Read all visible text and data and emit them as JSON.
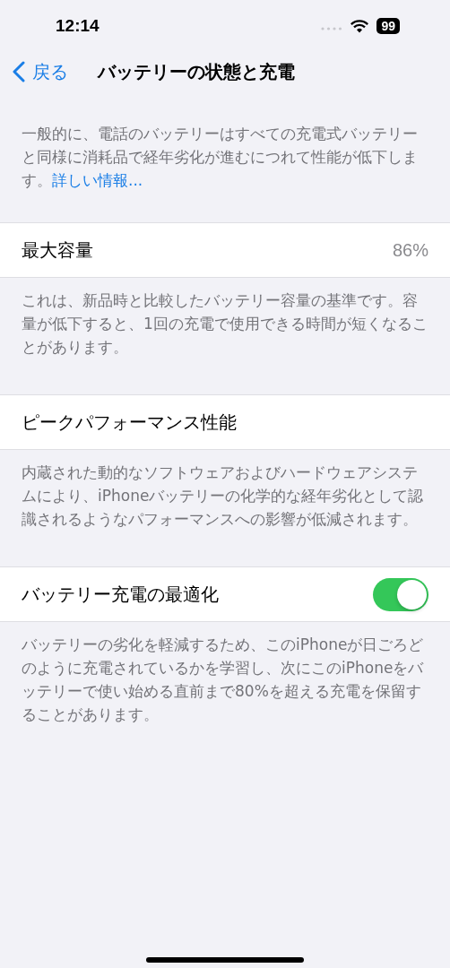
{
  "status_bar": {
    "time": "12:14",
    "battery": "99"
  },
  "nav": {
    "back": "戻る",
    "title": "バッテリーの状態と充電"
  },
  "intro": {
    "text": "一般的に、電話のバッテリーはすべての充電式バッテリーと同様に消耗品で経年劣化が進むにつれて性能が低下します。",
    "link": "詳しい情報..."
  },
  "sections": [
    {
      "kind": "value",
      "label": "最大容量",
      "value": "86%",
      "footer": "これは、新品時と比較したバッテリー容量の基準です。容量が低下すると、1回の充電で使用できる時間が短くなることがあります。"
    },
    {
      "kind": "plain",
      "label": "ピークパフォーマンス性能",
      "footer": "内蔵された動的なソフトウェアおよびハードウェアシステムにより、iPhoneバッテリーの化学的な経年劣化として認識されるようなパフォーマンスへの影響が低減されます。"
    },
    {
      "kind": "toggle",
      "label": "バッテリー充電の最適化",
      "on": true,
      "footer": "バッテリーの劣化を軽減するため、このiPhoneが日ごろどのように充電されているかを学習し、次にこのiPhoneをバッテリーで使い始める直前まで80%を超える充電を保留することがあります。"
    }
  ]
}
